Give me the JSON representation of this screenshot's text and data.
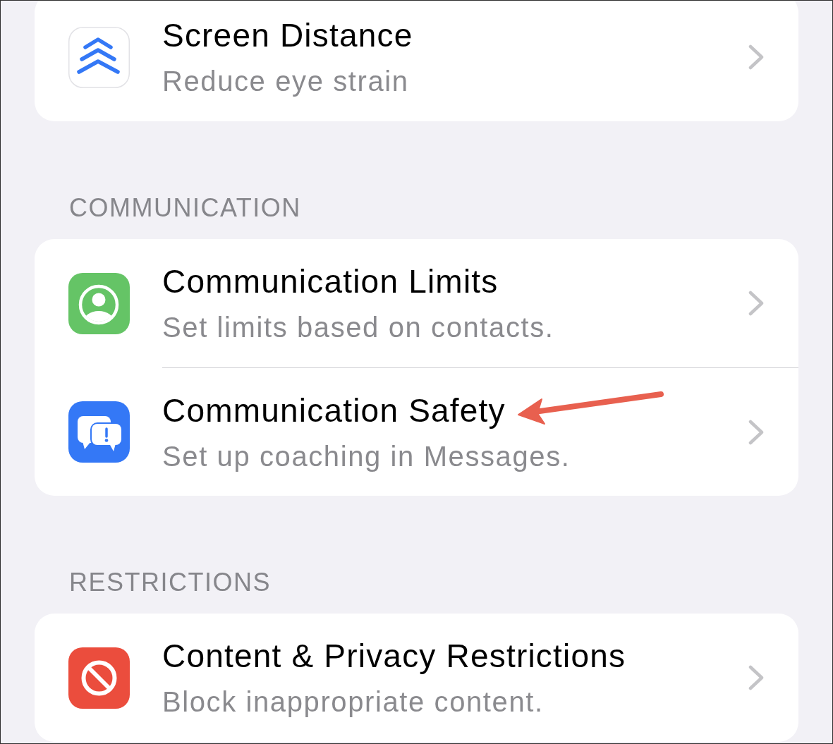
{
  "sections": [
    {
      "rows": [
        {
          "kind": "distance",
          "title": "Screen Distance",
          "subtitle": "Reduce eye strain",
          "annotated": false
        }
      ]
    },
    {
      "header": "COMMUNICATION",
      "rows": [
        {
          "kind": "limits",
          "title": "Communication Limits",
          "subtitle": "Set limits based on contacts.",
          "annotated": false
        },
        {
          "kind": "safety",
          "title": "Communication Safety",
          "subtitle": "Set up coaching in Messages.",
          "annotated": true
        }
      ]
    },
    {
      "header": "RESTRICTIONS",
      "rows": [
        {
          "kind": "restrictions",
          "title": "Content & Privacy Restrictions",
          "subtitle": "Block inappropriate content.",
          "annotated": false
        }
      ]
    }
  ]
}
